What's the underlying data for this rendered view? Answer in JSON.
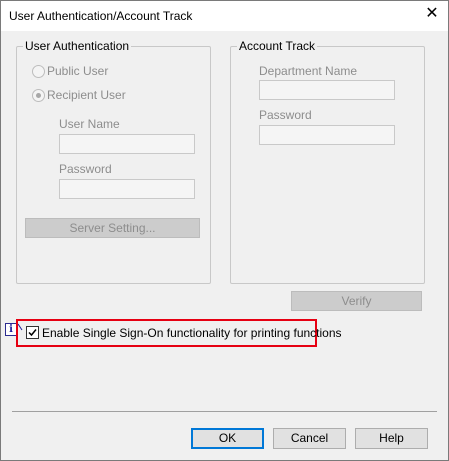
{
  "window": {
    "title": "User Authentication/Account Track",
    "close_glyph": "✕"
  },
  "user_auth": {
    "group_label": "User Authentication",
    "public_user_label": "Public User",
    "recipient_user_label": "Recipient User",
    "selected": "recipient_user",
    "user_name_label": "User Name",
    "user_name_value": "",
    "password_label": "Password",
    "password_value": "",
    "server_setting_label": "Server Setting..."
  },
  "account_track": {
    "group_label": "Account Track",
    "department_name_label": "Department Name",
    "department_name_value": "",
    "password_label": "Password",
    "password_value": ""
  },
  "verify_label": "Verify",
  "sso": {
    "label": "Enable Single Sign-On functionality for printing functions",
    "checked": true,
    "info_glyph": "i",
    "highlight_color": "#e60012"
  },
  "buttons": {
    "ok": "OK",
    "cancel": "Cancel",
    "help": "Help"
  }
}
